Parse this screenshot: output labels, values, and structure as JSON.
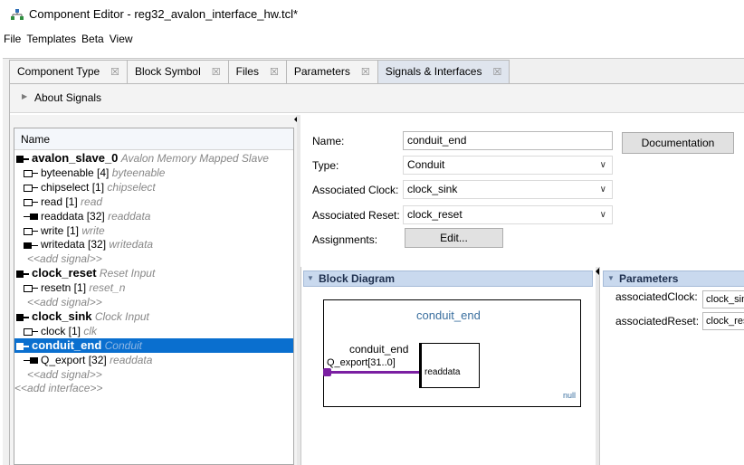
{
  "window": {
    "title": "Component Editor - reg32_avalon_interface_hw.tcl*",
    "app_icon": "network-icon"
  },
  "menu": [
    "File",
    "Templates",
    "Beta",
    "View"
  ],
  "tabs": [
    {
      "label": "Component Type",
      "active": false
    },
    {
      "label": "Block Symbol",
      "active": false
    },
    {
      "label": "Files",
      "active": false
    },
    {
      "label": "Parameters",
      "active": false
    },
    {
      "label": "Signals & Interfaces",
      "active": true
    }
  ],
  "tab_close_glyph": "☒",
  "about_section": {
    "label": "About Signals",
    "expand_icon": "chevron-right-icon"
  },
  "tree": {
    "header": "Name",
    "rows": [
      {
        "level": 0,
        "kind": "interface",
        "name": "avalon_slave_0",
        "type": "Avalon Memory Mapped Slave"
      },
      {
        "level": 1,
        "kind": "in",
        "name": "byteenable [4]",
        "type": "byteenable"
      },
      {
        "level": 1,
        "kind": "in",
        "name": "chipselect [1]",
        "type": "chipselect"
      },
      {
        "level": 1,
        "kind": "in",
        "name": "read [1]",
        "type": "read"
      },
      {
        "level": 1,
        "kind": "out",
        "name": "readdata [32]",
        "type": "readdata"
      },
      {
        "level": 1,
        "kind": "in",
        "name": "write [1]",
        "type": "write"
      },
      {
        "level": 1,
        "kind": "inout",
        "name": "writedata [32]",
        "type": "writedata"
      },
      {
        "level": 1,
        "kind": "add",
        "name": "",
        "type": "<<add signal>>"
      },
      {
        "level": 0,
        "kind": "interface",
        "name": "clock_reset",
        "type": "Reset Input"
      },
      {
        "level": 1,
        "kind": "in",
        "name": "resetn [1]",
        "type": "reset_n"
      },
      {
        "level": 1,
        "kind": "add",
        "name": "",
        "type": "<<add signal>>"
      },
      {
        "level": 0,
        "kind": "interface",
        "name": "clock_sink",
        "type": "Clock Input"
      },
      {
        "level": 1,
        "kind": "in",
        "name": "clock [1]",
        "type": "clk"
      },
      {
        "level": 0,
        "kind": "interface",
        "name": "conduit_end",
        "type": "Conduit",
        "selected": true
      },
      {
        "level": 1,
        "kind": "out",
        "name": "Q_export [32]",
        "type": "readdata"
      },
      {
        "level": 1,
        "kind": "add",
        "name": "",
        "type": "<<add signal>>"
      },
      {
        "level": 0,
        "kind": "add",
        "name": "",
        "type": "<<add interface>>"
      }
    ]
  },
  "form": {
    "name_label": "Name:",
    "name_value": "conduit_end",
    "type_label": "Type:",
    "type_value": "Conduit",
    "clock_label": "Associated Clock:",
    "clock_value": "clock_sink",
    "reset_label": "Associated Reset:",
    "reset_value": "clock_reset",
    "assignments_label": "Assignments:",
    "edit_button": "Edit...",
    "doc_button": "Documentation",
    "dropdown_icon": "chevron-down-icon"
  },
  "block_diagram": {
    "title": "Block Diagram",
    "component_name": "conduit_end",
    "interface_label": "conduit_end",
    "port_label": "Q_export[31..0]",
    "signal_type": "readdata",
    "footer": "null"
  },
  "parameters": {
    "title": "Parameters",
    "rows": [
      {
        "label": "associatedClock:",
        "value": "clock_sink"
      },
      {
        "label": "associatedReset:",
        "value": "clock_reset"
      }
    ]
  },
  "colors": {
    "selection": "#0a6fcf",
    "panel_header": "#c9d9ee",
    "wire": "#7b1fa2",
    "diagram_text": "#3a6f9f"
  }
}
